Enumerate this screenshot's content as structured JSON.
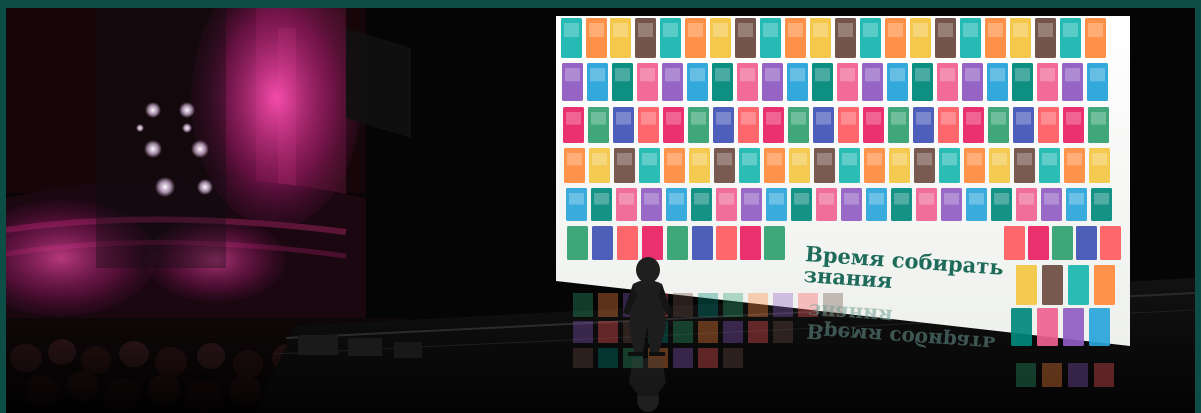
{
  "photo": {
    "screen_text": "Время собирать\nзнания",
    "reflection_text": "Время собирать\nзнания"
  },
  "colors": {
    "frame": "#0c4e45",
    "theater": "#050505",
    "screen": "#f4f5f2",
    "headline": "#1f6b5b",
    "magenta": "#d9268c"
  },
  "scene": {
    "type": "stage-presentation",
    "elements": [
      "theater",
      "audience",
      "screen",
      "presenter",
      "reflection"
    ]
  }
}
